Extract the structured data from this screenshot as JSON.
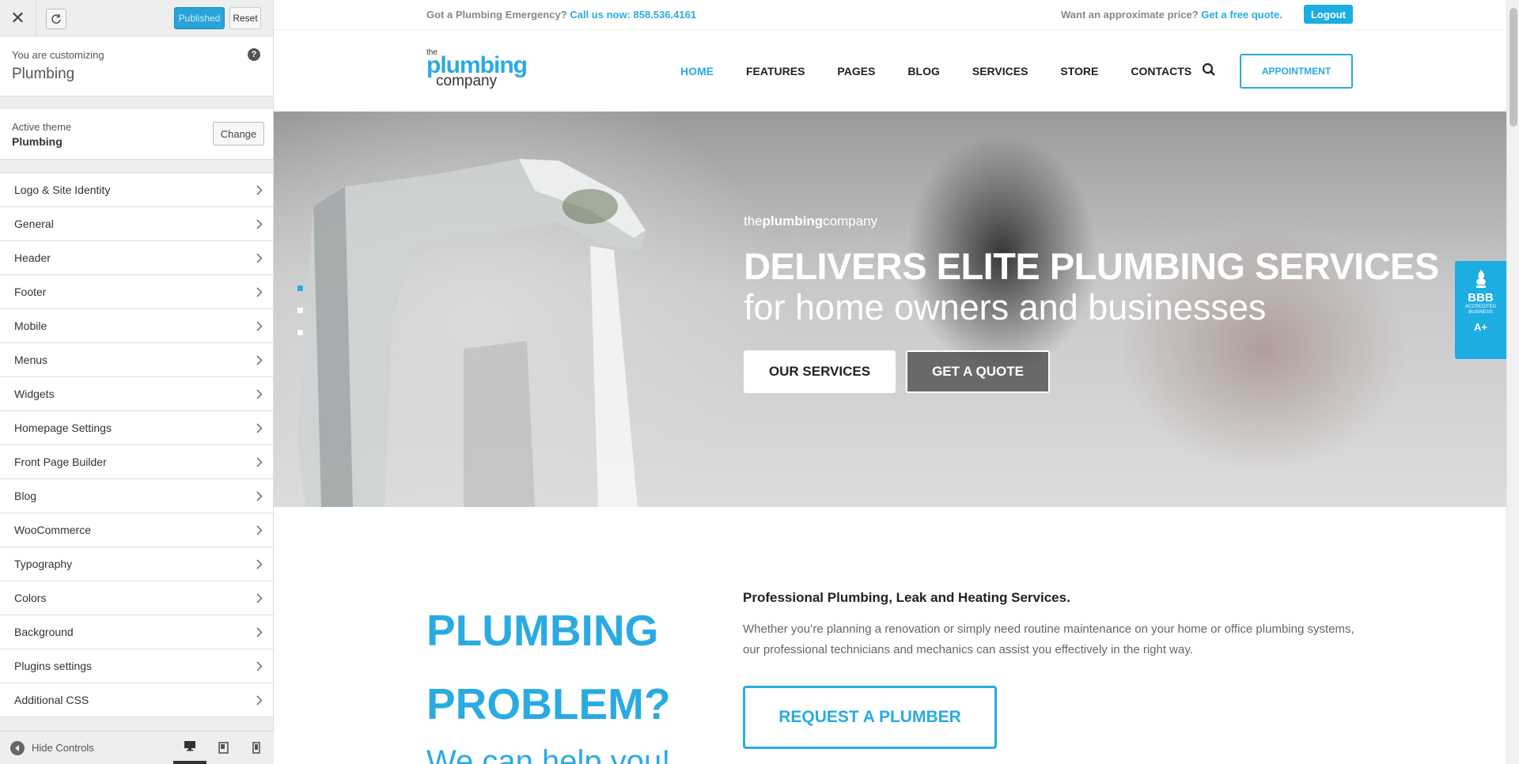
{
  "sidebar": {
    "close_glyph": "✕",
    "published_label": "Published",
    "reset_label": "Reset",
    "customizing_label": "You are customizing",
    "site_name": "Plumbing",
    "help_glyph": "?",
    "active_theme_label": "Active theme",
    "active_theme_name": "Plumbing",
    "change_label": "Change",
    "items": [
      {
        "label": "Logo & Site Identity"
      },
      {
        "label": "General"
      },
      {
        "label": "Header"
      },
      {
        "label": "Footer"
      },
      {
        "label": "Mobile"
      },
      {
        "label": "Menus"
      },
      {
        "label": "Widgets"
      },
      {
        "label": "Homepage Settings"
      },
      {
        "label": "Front Page Builder"
      },
      {
        "label": "Blog"
      },
      {
        "label": "WooCommerce"
      },
      {
        "label": "Typography"
      },
      {
        "label": "Colors"
      },
      {
        "label": "Background"
      },
      {
        "label": "Plugins settings"
      },
      {
        "label": "Additional CSS"
      }
    ],
    "hide_controls_label": "Hide Controls",
    "devices": [
      "desktop",
      "tablet",
      "mobile"
    ]
  },
  "preview": {
    "topbar": {
      "emergency_text": "Got a Plumbing Emergency?",
      "call_link": "Call us now: 858.536.4161",
      "price_text": "Want an approximate price?",
      "quote_link": "Get a free quote.",
      "logout_label": "Logout"
    },
    "logo": {
      "the": "the",
      "plumbing": "plumbing",
      "company": "company"
    },
    "nav": [
      "HOME",
      "FEATURES",
      "PAGES",
      "BLOG",
      "SERVICES",
      "STORE",
      "CONTACTS"
    ],
    "appointment_label": "APPOINTMENT",
    "hero": {
      "brand_pre": "the",
      "brand_bold": "plumbing",
      "brand_post": "company",
      "title": "DELIVERS ELITE PLUMBING SERVICES",
      "subtitle": "for home owners and businesses",
      "primary_button": "OUR SERVICES",
      "secondary_button": "GET A QUOTE",
      "slides_count": 3,
      "active_slide": 1
    },
    "bbb": {
      "logo": "BBB",
      "text": "ACCREDITED BUSINESS",
      "grade": "A+"
    },
    "intro": {
      "title_line1": "PLUMBING",
      "title_line2": "PROBLEM?",
      "subtitle": "We can help you!",
      "heading": "Professional Plumbing, Leak and Heating Services.",
      "body": "Whether you’re planning a renovation or simply need routine maintenance on your home or office plumbing systems, our professional technicians and mechanics can assist you effectively in the right way.",
      "button": "REQUEST A PLUMBER"
    }
  },
  "colors": {
    "accent": "#29abe2",
    "published": "#29a4d6",
    "sidebar_bg": "#eeeeee"
  }
}
